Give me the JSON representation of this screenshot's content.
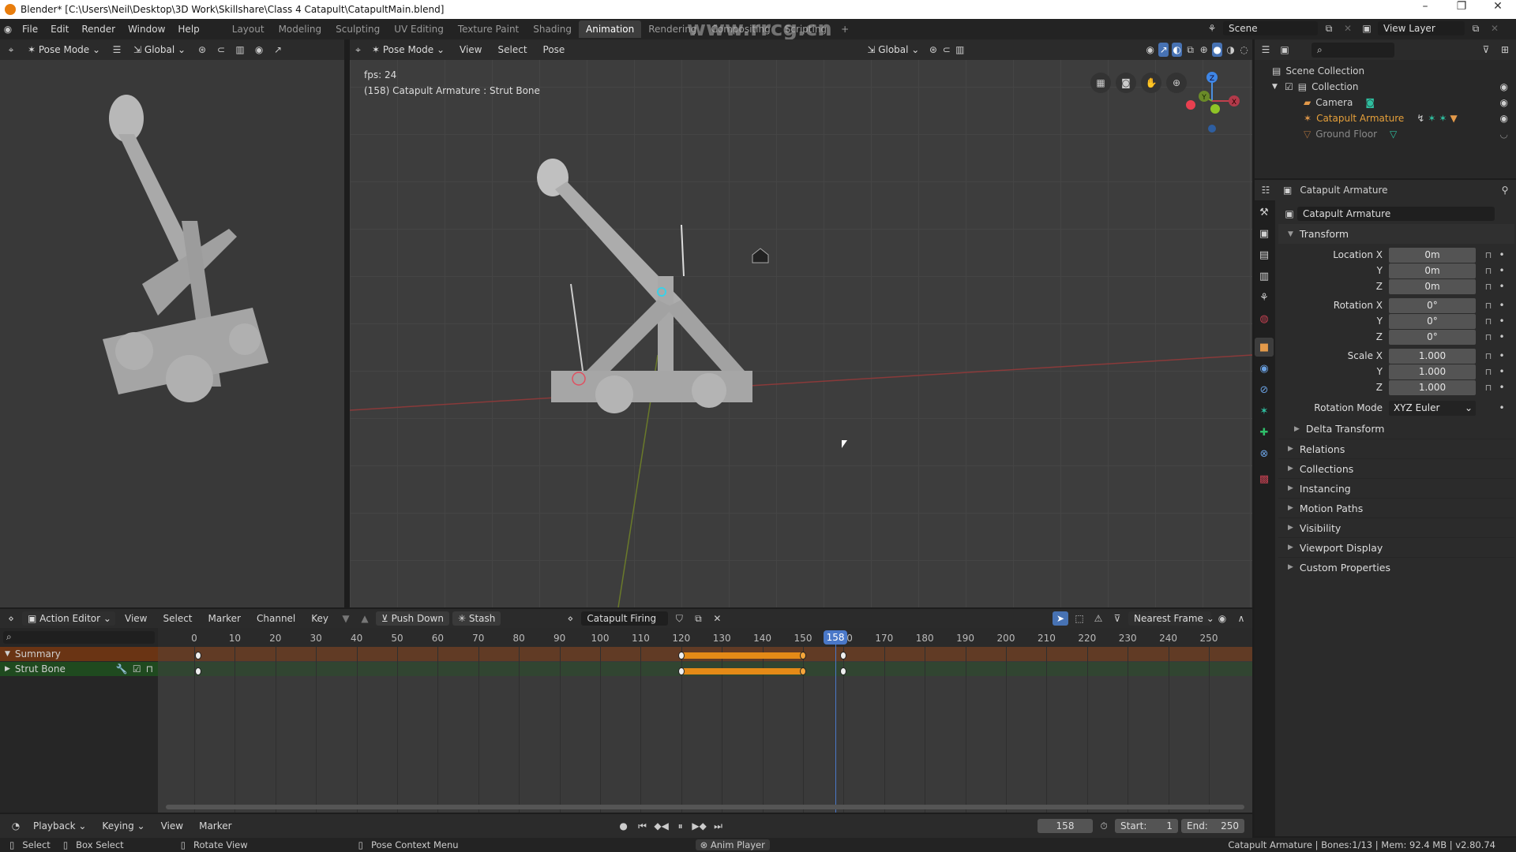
{
  "window": {
    "title": "Blender* [C:\\Users\\Neil\\Desktop\\3D Work\\Skillshare\\Class 4 Catapult\\CatapultMain.blend]",
    "controls": [
      "–",
      "❐",
      "✕"
    ]
  },
  "topbar": {
    "menus": [
      "File",
      "Edit",
      "Render",
      "Window",
      "Help"
    ],
    "workspaces": [
      "Layout",
      "Modeling",
      "Sculpting",
      "UV Editing",
      "Texture Paint",
      "Shading",
      "Animation",
      "Rendering",
      "Compositing",
      "Scripting",
      "+"
    ],
    "active_workspace": "Animation",
    "scene": "Scene",
    "view_layer": "View Layer"
  },
  "watermark": "www.rrcg.cn",
  "left_viewport": {
    "mode": "Pose Mode",
    "orientation": "Global"
  },
  "main_viewport": {
    "mode": "Pose Mode",
    "menus": [
      "View",
      "Select",
      "Pose"
    ],
    "orientation": "Global",
    "overlay_fps": "fps: 24",
    "overlay_info": "(158) Catapult Armature : Strut Bone",
    "gizmo": {
      "z": "Z",
      "y": "Y",
      "x": "X"
    }
  },
  "outliner": {
    "search_placeholder": "",
    "root": "Scene Collection",
    "collection": "Collection",
    "items": [
      {
        "name": "Camera",
        "color": "#cfcfcf"
      },
      {
        "name": "Catapult Armature",
        "color": "#e6a03a"
      },
      {
        "name": "Ground Floor",
        "color": "#8a8a8a"
      }
    ]
  },
  "properties": {
    "header_object": "Catapult Armature",
    "object_name": "Catapult Armature",
    "transform_label": "Transform",
    "rows": [
      {
        "label": "Location X",
        "value": "0m"
      },
      {
        "label": "Y",
        "value": "0m"
      },
      {
        "label": "Z",
        "value": "0m"
      },
      {
        "label": "Rotation X",
        "value": "0°"
      },
      {
        "label": "Y",
        "value": "0°"
      },
      {
        "label": "Z",
        "value": "0°"
      },
      {
        "label": "Scale X",
        "value": "1.000"
      },
      {
        "label": "Y",
        "value": "1.000"
      },
      {
        "label": "Z",
        "value": "1.000"
      }
    ],
    "rotation_mode_label": "Rotation Mode",
    "rotation_mode": "XYZ Euler",
    "delta_transform": "Delta Transform",
    "sections": [
      "Relations",
      "Collections",
      "Instancing",
      "Motion Paths",
      "Visibility",
      "Viewport Display",
      "Custom Properties"
    ]
  },
  "action_editor": {
    "editor_type": "Action Editor",
    "menus": [
      "View",
      "Select",
      "Marker",
      "Channel",
      "Key"
    ],
    "push_down": "Push Down",
    "stash": "Stash",
    "action_name": "Catapult Firing",
    "snap_mode": "Nearest Frame",
    "ticks": [
      0,
      10,
      20,
      30,
      40,
      50,
      60,
      70,
      80,
      90,
      100,
      110,
      120,
      130,
      140,
      150,
      160,
      170,
      180,
      190,
      200,
      210,
      220,
      230,
      240,
      250
    ],
    "current_frame": 158,
    "channels": [
      {
        "name": "Summary",
        "expanded": true
      },
      {
        "name": "Strut Bone",
        "expanded": false
      }
    ],
    "keyframes": [
      1,
      120,
      150,
      160
    ],
    "holds": [
      [
        120,
        150
      ]
    ]
  },
  "timeline": {
    "menus": [
      "Playback",
      "Keying",
      "View",
      "Marker"
    ],
    "current_frame": "158",
    "start_label": "Start:",
    "start": "1",
    "end_label": "End:",
    "end": "250"
  },
  "statusbar": {
    "hints": [
      "Select",
      "Box Select",
      "Rotate View",
      "Pose Context Menu"
    ],
    "anim_player": "Anim Player",
    "info": "Catapult Armature | Bones:1/13  | Mem: 92.4 MB | v2.80.74"
  }
}
